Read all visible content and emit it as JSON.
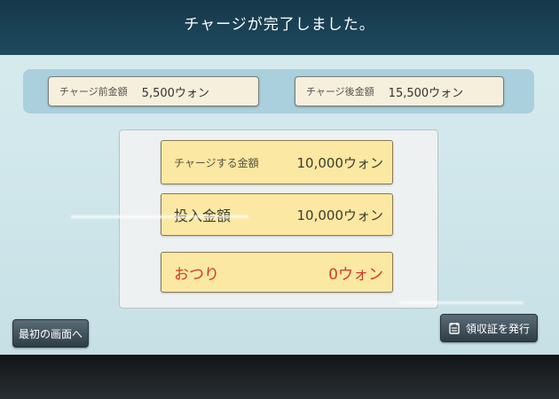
{
  "header": {
    "title": "チャージが完了しました。"
  },
  "summary": {
    "before": {
      "label": "チャージ前金額",
      "value": "5,500ウォン"
    },
    "after": {
      "label": "チャージ後金額",
      "value": "15,500ウォン"
    }
  },
  "details": {
    "charge": {
      "label": "チャージする金額",
      "value": "10,000ウォン"
    },
    "inserted": {
      "label": "投入金額",
      "value": "10,000ウォン"
    },
    "change": {
      "label": "おつり",
      "value": "0ウォン"
    }
  },
  "buttons": {
    "home_label": "最初の画面へ",
    "receipt_label": "領収証を発行",
    "receipt_icon": "receipt-icon"
  },
  "colors": {
    "header": "#16384a",
    "amount_box": "#fbe8a2",
    "change_text": "#d03a2c",
    "button": "#3b4a54"
  }
}
